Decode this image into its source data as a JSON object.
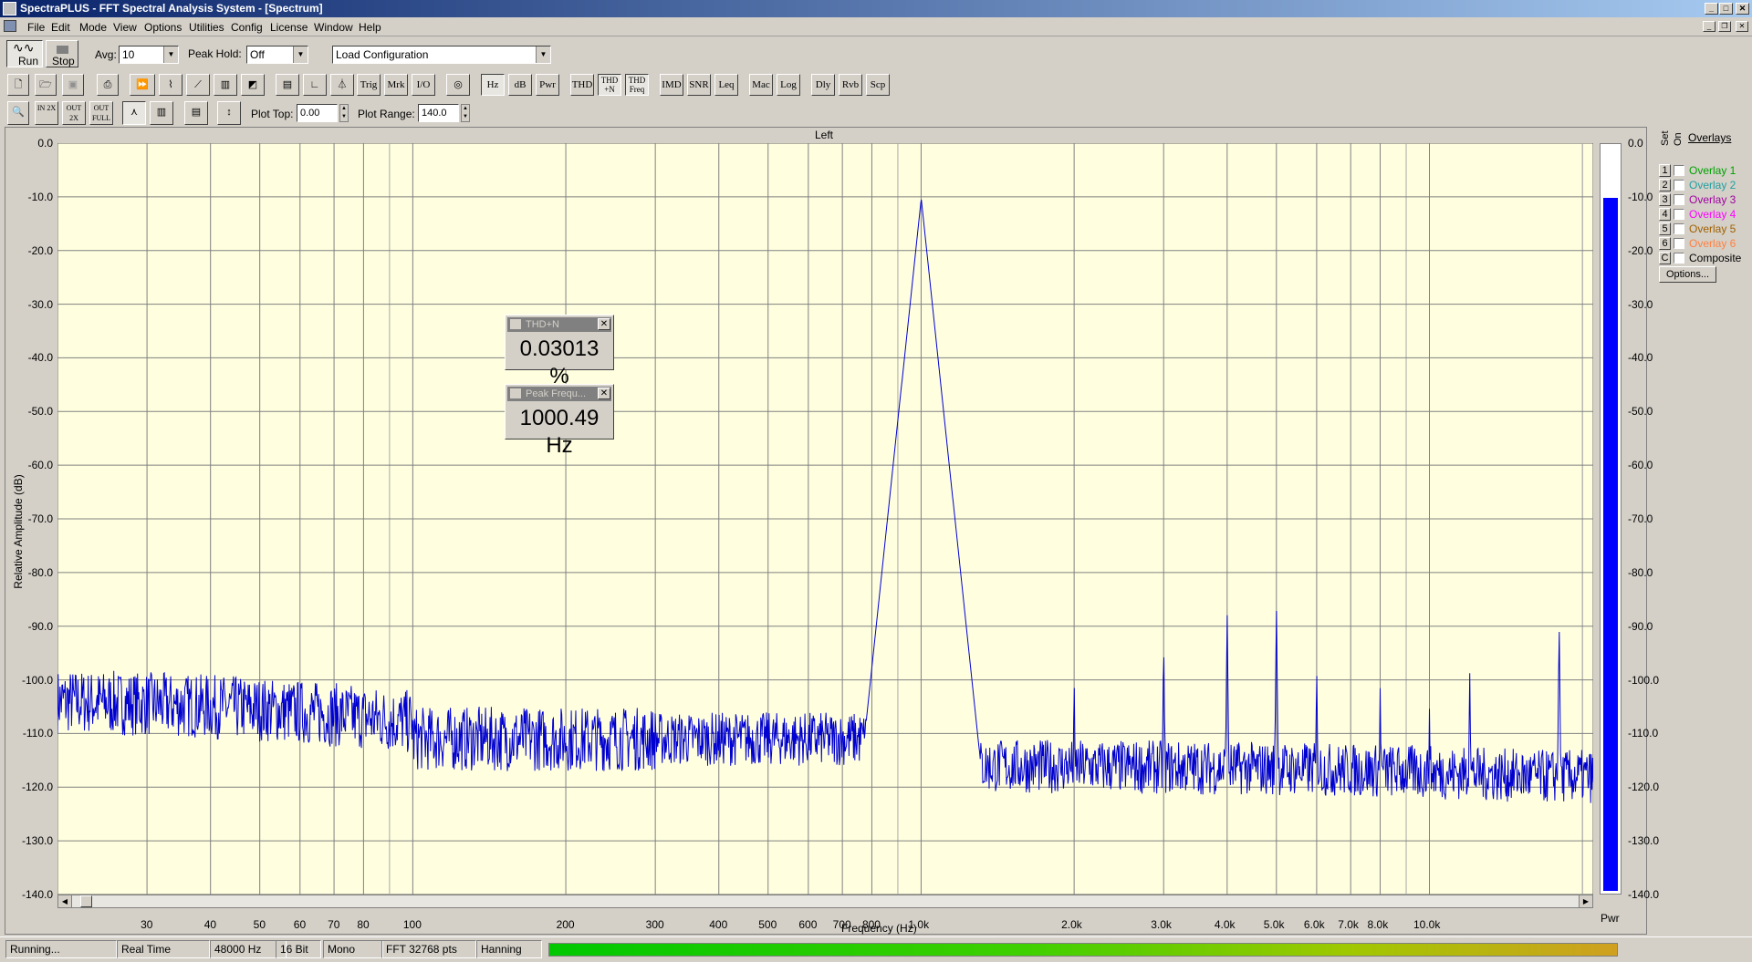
{
  "window": {
    "title": "SpectraPLUS - FFT Spectral Analysis System - [Spectrum]"
  },
  "menu": [
    "File",
    "Edit",
    "Mode",
    "View",
    "Options",
    "Utilities",
    "Config",
    "License",
    "Window",
    "Help"
  ],
  "toolbar1": {
    "run_label": "Run",
    "stop_label": "Stop",
    "avg_label": "Avg:",
    "avg_value": "10",
    "peak_hold_label": "Peak Hold:",
    "peak_hold_value": "Off",
    "config_value": "Load Configuration"
  },
  "toolbar2": [
    "Trig",
    "Mrk",
    "I/O",
    "Hz",
    "dB",
    "Pwr",
    "THD",
    "THD +N",
    "THD Freq",
    "IMD",
    "SNR",
    "Leq",
    "Mac",
    "Log",
    "Dly",
    "Rvb",
    "Scp"
  ],
  "toolbar3": {
    "zoom_in": "IN 2X",
    "zoom_out": "OUT 2X",
    "zoom_full": "OUT FULL",
    "plot_top_label": "Plot Top:",
    "plot_top_value": "0.00",
    "plot_range_label": "Plot Range:",
    "plot_range_value": "140.0"
  },
  "plot": {
    "channel_title": "Left",
    "ylabel": "Relative Amplitude (dB)",
    "xlabel": "Frequency (Hz)",
    "y_ticks": [
      "0.0",
      "-10.0",
      "-20.0",
      "-30.0",
      "-40.0",
      "-50.0",
      "-60.0",
      "-70.0",
      "-80.0",
      "-90.0",
      "-100.0",
      "-110.0",
      "-120.0",
      "-130.0",
      "-140.0"
    ],
    "x_ticks": [
      "30",
      "40",
      "50",
      "60",
      "70",
      "80",
      "100",
      "200",
      "300",
      "400",
      "500",
      "600",
      "700",
      "800",
      "1.0k",
      "2.0k",
      "3.0k",
      "4.0k",
      "5.0k",
      "6.0k",
      "7.0k",
      "8.0k",
      "10.0k"
    ],
    "bar_label": "Pwr",
    "bar_ticks": [
      "0.0",
      "-10.0",
      "-20.0",
      "-30.0",
      "-40.0",
      "-50.0",
      "-60.0",
      "-70.0",
      "-80.0",
      "-90.0",
      "-100.0",
      "-110.0",
      "-120.0",
      "-130.0",
      "-140.0"
    ],
    "bar_level_db": -10.0,
    "trace_color": "#0000d0",
    "background_color": "#ffffe0",
    "peak_hz": 1000.49,
    "peak_db": -10.3,
    "noise_floor_db": -118,
    "harmonics": [
      {
        "hz": 2000,
        "db": -99
      },
      {
        "hz": 3000,
        "db": -92
      },
      {
        "hz": 4000,
        "db": -87
      },
      {
        "hz": 5000,
        "db": -86
      },
      {
        "hz": 6000,
        "db": -97
      },
      {
        "hz": 8000,
        "db": -101
      },
      {
        "hz": 10000,
        "db": -105
      },
      {
        "hz": 12000,
        "db": -98
      },
      {
        "hz": 18000,
        "db": -89
      }
    ]
  },
  "meters": {
    "thd": {
      "title": "THD+N",
      "value": "0.03013 %"
    },
    "peak": {
      "title": "Peak Frequ...",
      "value": "1000.49 Hz"
    }
  },
  "overlays": {
    "title": "Overlays",
    "set_label": "Set",
    "on_label": "On",
    "items": [
      {
        "num": "1",
        "name": "Overlay 1",
        "color": "#00a000"
      },
      {
        "num": "2",
        "name": "Overlay 2",
        "color": "#20a0a0"
      },
      {
        "num": "3",
        "name": "Overlay 3",
        "color": "#a000a0"
      },
      {
        "num": "4",
        "name": "Overlay 4",
        "color": "#ff00ff"
      },
      {
        "num": "5",
        "name": "Overlay 5",
        "color": "#a06000"
      },
      {
        "num": "6",
        "name": "Overlay 6",
        "color": "#ff8040"
      },
      {
        "num": "C",
        "name": "Composite",
        "color": "#000000"
      }
    ],
    "options_label": "Options..."
  },
  "status": [
    "Running...",
    "Real Time",
    "48000 Hz",
    "16 Bit",
    "Mono",
    "FFT 32768 pts",
    "Hanning"
  ]
}
